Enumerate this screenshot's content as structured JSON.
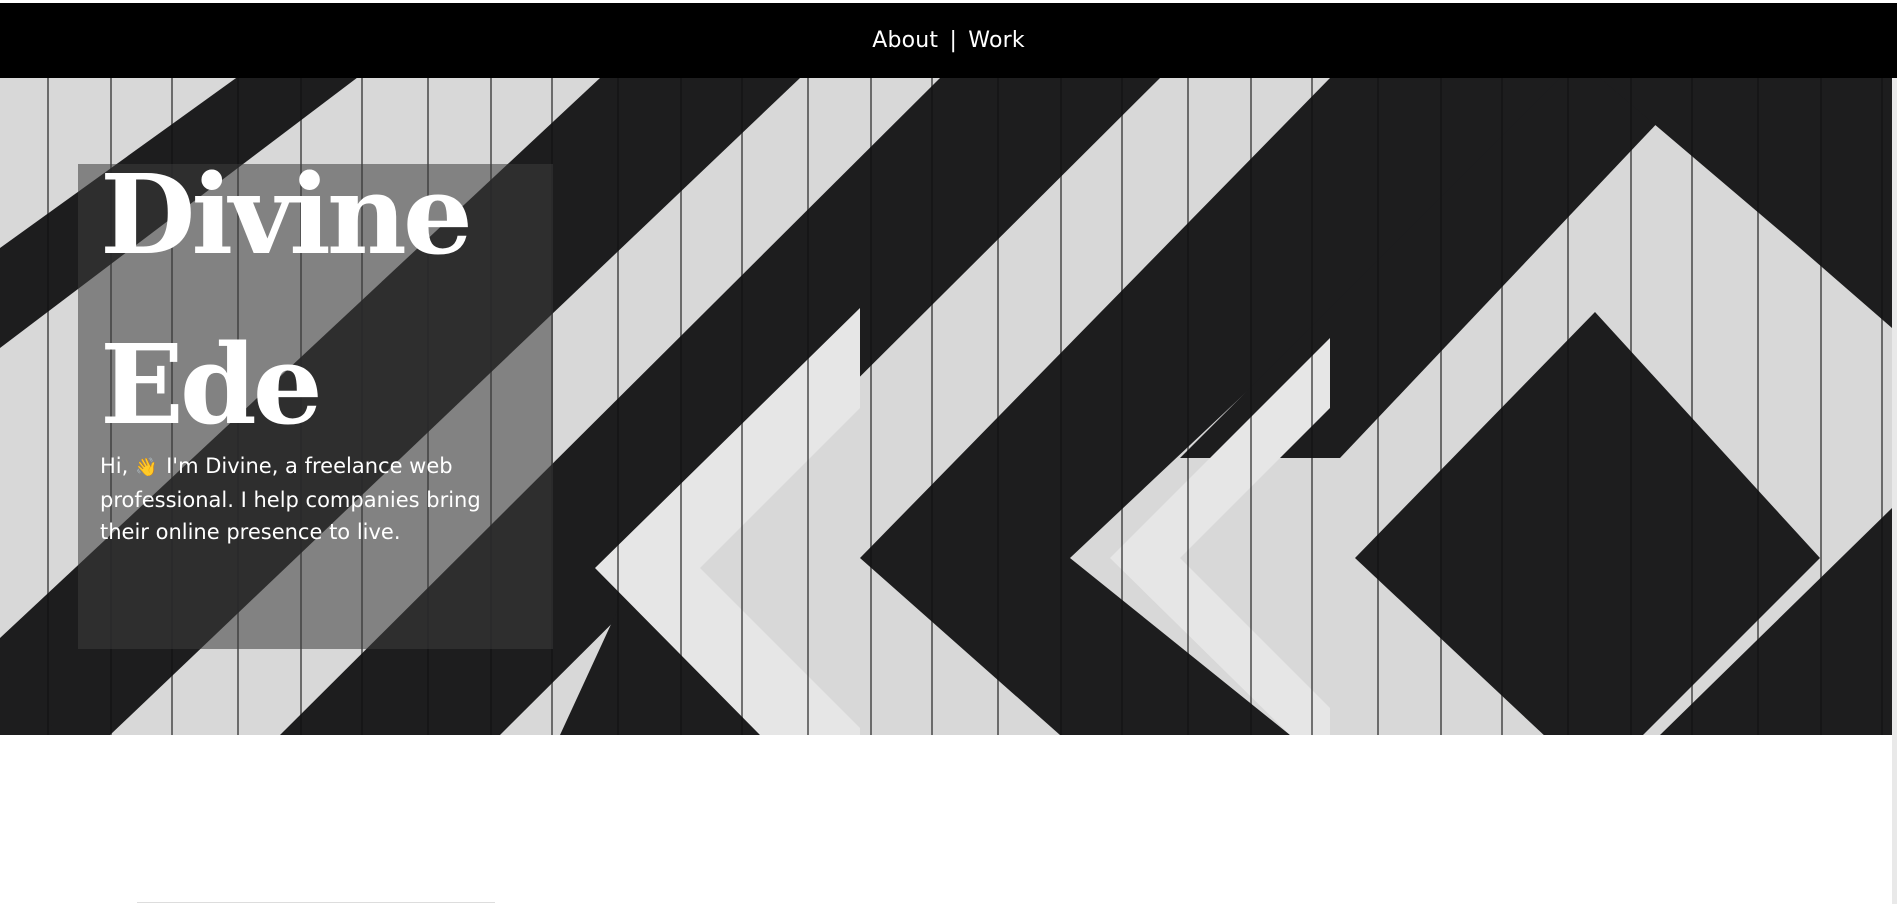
{
  "nav": {
    "about": "About",
    "separator": "|",
    "work": "Work"
  },
  "hero": {
    "name_line1": "Divine",
    "name_line2": "Ede",
    "greeting": "Hi,",
    "wave_icon": "👋",
    "intro_text": "I'm Divine, a freelance web professional. I help companies bring their online presence to live."
  },
  "colors": {
    "nav_bg": "#000000",
    "text": "#ffffff",
    "stripe_dark": "#1e1e1f",
    "stripe_light": "#d9d9d9"
  }
}
